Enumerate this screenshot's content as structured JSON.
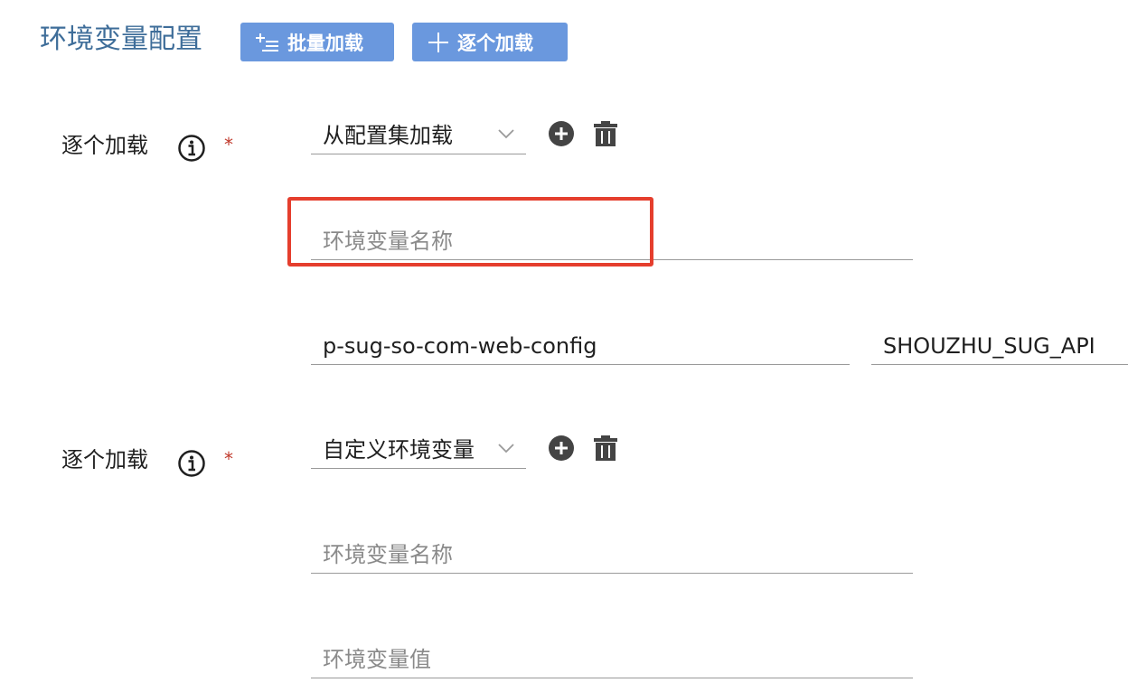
{
  "header": {
    "title": "环境变量配置",
    "batch_button": "批量加载",
    "single_button": "逐个加载"
  },
  "rows": [
    {
      "label": "逐个加载",
      "required": "*",
      "select_value": "从配置集加载",
      "fields": {
        "name_placeholder": "环境变量名称",
        "config_value": "p-sug-so-com-web-config",
        "key_value": "SHOUZHU_SUG_API"
      }
    },
    {
      "label": "逐个加载",
      "required": "*",
      "select_value": "自定义环境变量",
      "fields": {
        "name_placeholder": "环境变量名称",
        "value_placeholder": "环境变量值"
      }
    }
  ],
  "colors": {
    "accent": "#6a98de",
    "title": "#3e6d99",
    "highlight": "#e53e2d",
    "required": "#c0392b"
  },
  "icons": [
    "add-list-icon",
    "plus-icon",
    "info-icon",
    "chevron-down-icon",
    "add-circle-icon",
    "trash-icon"
  ]
}
